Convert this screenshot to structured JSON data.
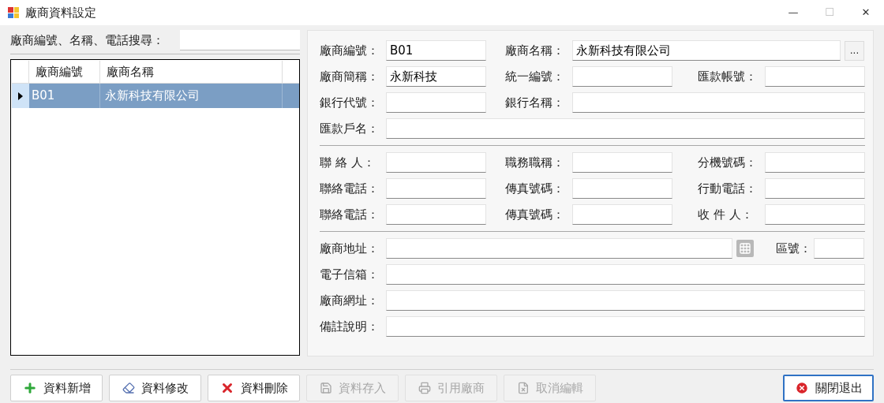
{
  "window": {
    "title": "廠商資料設定",
    "controls": [
      "—",
      "☐",
      "✕"
    ]
  },
  "search": {
    "label": "廠商編號、名稱、電話搜尋："
  },
  "grid": {
    "columns": [
      "廠商編號",
      "廠商名稱"
    ],
    "rows": [
      {
        "cells": [
          "B01",
          "永新科技有限公司"
        ],
        "selected": true
      }
    ]
  },
  "form": {
    "sections": [
      [
        [
          {
            "label": "廠商編號：",
            "value": "B01",
            "kind": "short"
          },
          {
            "label": "廠商名稱：",
            "value": "永新科技有限公司",
            "kind": "wide-button",
            "button": "..."
          }
        ],
        [
          {
            "label": "廠商簡稱：",
            "value": "永新科技",
            "kind": "short"
          },
          {
            "label": "統一編號：",
            "kind": "short"
          },
          {
            "label": "匯款帳號：",
            "kind": "short"
          }
        ],
        [
          {
            "label": "銀行代號：",
            "kind": "short"
          },
          {
            "label": "銀行名稱：",
            "kind": "wide"
          }
        ],
        [
          {
            "label": "匯款戶名：",
            "kind": "full"
          }
        ]
      ],
      [
        [
          {
            "label": "聯 絡 人：",
            "kind": "short"
          },
          {
            "label": "職務職稱：",
            "kind": "short"
          },
          {
            "label": "分機號碼：",
            "kind": "short"
          }
        ],
        [
          {
            "label": "聯絡電話：",
            "kind": "short"
          },
          {
            "label": "傳真號碼：",
            "kind": "short"
          },
          {
            "label": "行動電話：",
            "kind": "short"
          }
        ],
        [
          {
            "label": "聯絡電話：",
            "kind": "short"
          },
          {
            "label": "傳真號碼：",
            "kind": "short"
          },
          {
            "label": "收 件 人：",
            "kind": "short"
          }
        ]
      ],
      [
        [
          {
            "label": "廠商地址：",
            "kind": "address"
          },
          {
            "label": "區號：",
            "kind": "zip"
          }
        ],
        [
          {
            "label": "電子信箱：",
            "kind": "full"
          }
        ],
        [
          {
            "label": "廠商網址：",
            "kind": "full"
          }
        ],
        [
          {
            "label": "備註說明：",
            "kind": "full"
          }
        ]
      ]
    ]
  },
  "buttons": [
    {
      "label": "資料新增",
      "kind": "add",
      "disabled": false
    },
    {
      "label": "資料修改",
      "kind": "edit",
      "disabled": false
    },
    {
      "label": "資料刪除",
      "kind": "delete",
      "disabled": false
    },
    {
      "label": "資料存入",
      "kind": "save",
      "disabled": true
    },
    {
      "label": "引用廠商",
      "kind": "import",
      "disabled": true
    },
    {
      "label": "取消編輯",
      "kind": "cancel",
      "disabled": true
    }
  ],
  "close_button": {
    "label": "關閉退出"
  }
}
